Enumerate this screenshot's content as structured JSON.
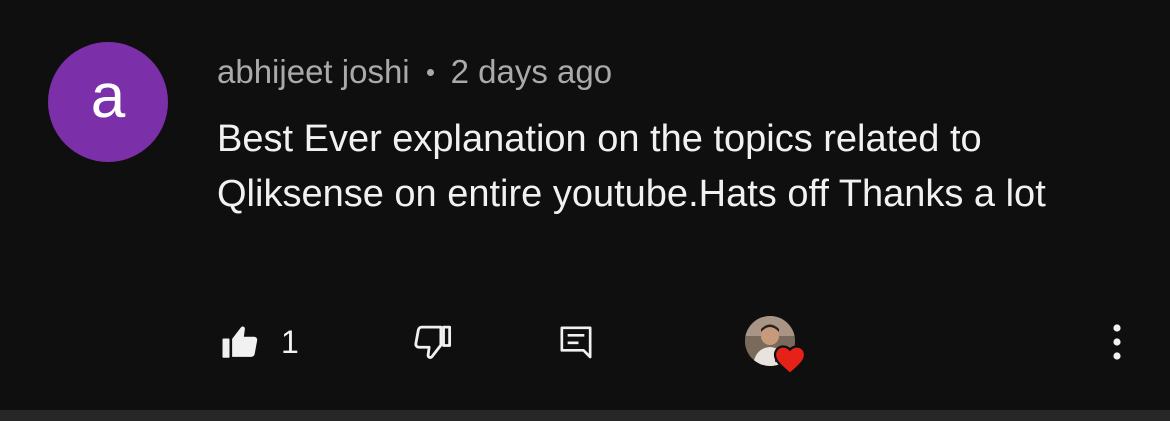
{
  "comment": {
    "author": "abhijeet joshi",
    "timestamp": "2 days ago",
    "avatar_letter": "a",
    "avatar_color": "#7b2fa8",
    "text": "Best Ever explanation on the topics related to Qliksense on entire youtube.Hats off Thanks a lot",
    "like_count": "1",
    "hearted_by_creator": true,
    "heart_color": "#e62117"
  },
  "icons": {
    "like": "thumbs-up-filled-icon",
    "dislike": "thumbs-down-icon",
    "reply": "comment-reply-icon",
    "more": "more-vertical-icon"
  }
}
